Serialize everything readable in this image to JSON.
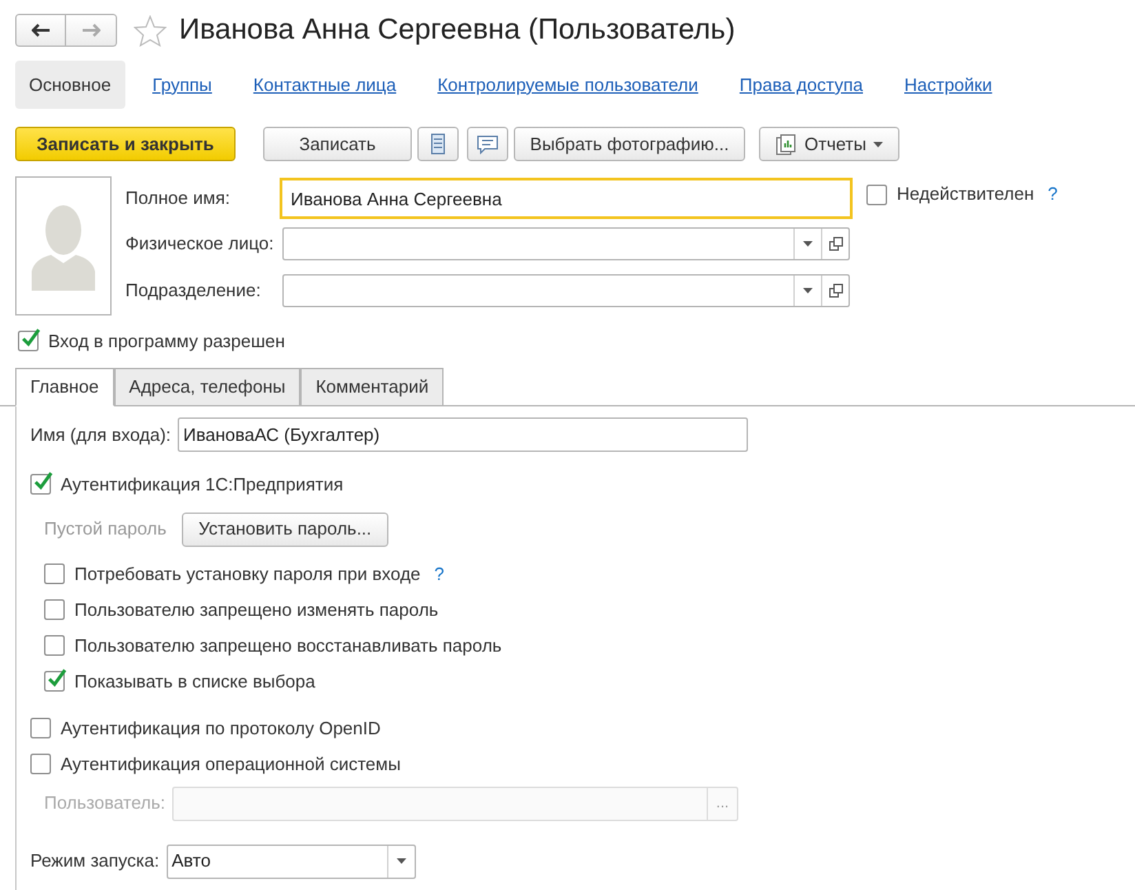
{
  "header": {
    "title": "Иванова Анна Сергеевна (Пользователь)",
    "favorite": false
  },
  "sections": [
    {
      "label": "Основное",
      "selected": true
    },
    {
      "label": "Группы",
      "selected": false
    },
    {
      "label": "Контактные лица",
      "selected": false
    },
    {
      "label": "Контролируемые пользователи",
      "selected": false
    },
    {
      "label": "Права доступа",
      "selected": false
    },
    {
      "label": "Настройки",
      "selected": false
    }
  ],
  "toolbar": [
    {
      "kind": "primary",
      "label": "Записать и закрыть"
    },
    {
      "kind": "text",
      "label": "Записать"
    },
    {
      "kind": "list-icon"
    },
    {
      "kind": "comment-icon"
    },
    {
      "kind": "text",
      "label": "Выбрать фотографию..."
    },
    {
      "kind": "reports",
      "label": "Отчеты"
    }
  ],
  "fields": [
    {
      "kind": "input",
      "label": "Полное имя:",
      "value": "Иванова Анна Сергеевна",
      "focused": true
    },
    {
      "kind": "combo",
      "label": "Физическое лицо:"
    },
    {
      "kind": "combo",
      "label": "Подразделение:"
    }
  ],
  "invalid": {
    "label": "Недействителен",
    "checked": false,
    "help": "?"
  },
  "login_allowed": {
    "label": "Вход в программу разрешен",
    "checked": true
  },
  "tabs": [
    {
      "label": "Главное",
      "selected": true
    },
    {
      "label": "Адреса, телефоны",
      "selected": false
    },
    {
      "label": "Комментарий",
      "selected": false
    }
  ],
  "main": {
    "login_name": {
      "label": "Имя (для входа):",
      "value": "ИвановаАС (Бухгалтер)"
    },
    "auth_1c": {
      "label": "Аутентификация 1С:Предприятия",
      "checked": true
    },
    "password_status": "Пустой пароль",
    "set_password": "Установить пароль...",
    "options": [
      {
        "label": "Потребовать установку пароля при входе",
        "checked": false,
        "help": "?"
      },
      {
        "label": "Пользователю запрещено изменять пароль",
        "checked": false
      },
      {
        "label": "Пользователю запрещено восстанавливать пароль",
        "checked": false
      },
      {
        "label": "Показывать в списке выбора",
        "checked": true
      }
    ],
    "auth_openid": {
      "label": "Аутентификация по протоколу OpenID",
      "checked": false
    },
    "auth_os": {
      "label": "Аутентификация операционной системы",
      "checked": false
    },
    "os_user": {
      "label": "Пользователь:",
      "disabled": true,
      "button": "..."
    },
    "launch_mode": {
      "label": "Режим запуска:",
      "value": "Авто"
    }
  }
}
